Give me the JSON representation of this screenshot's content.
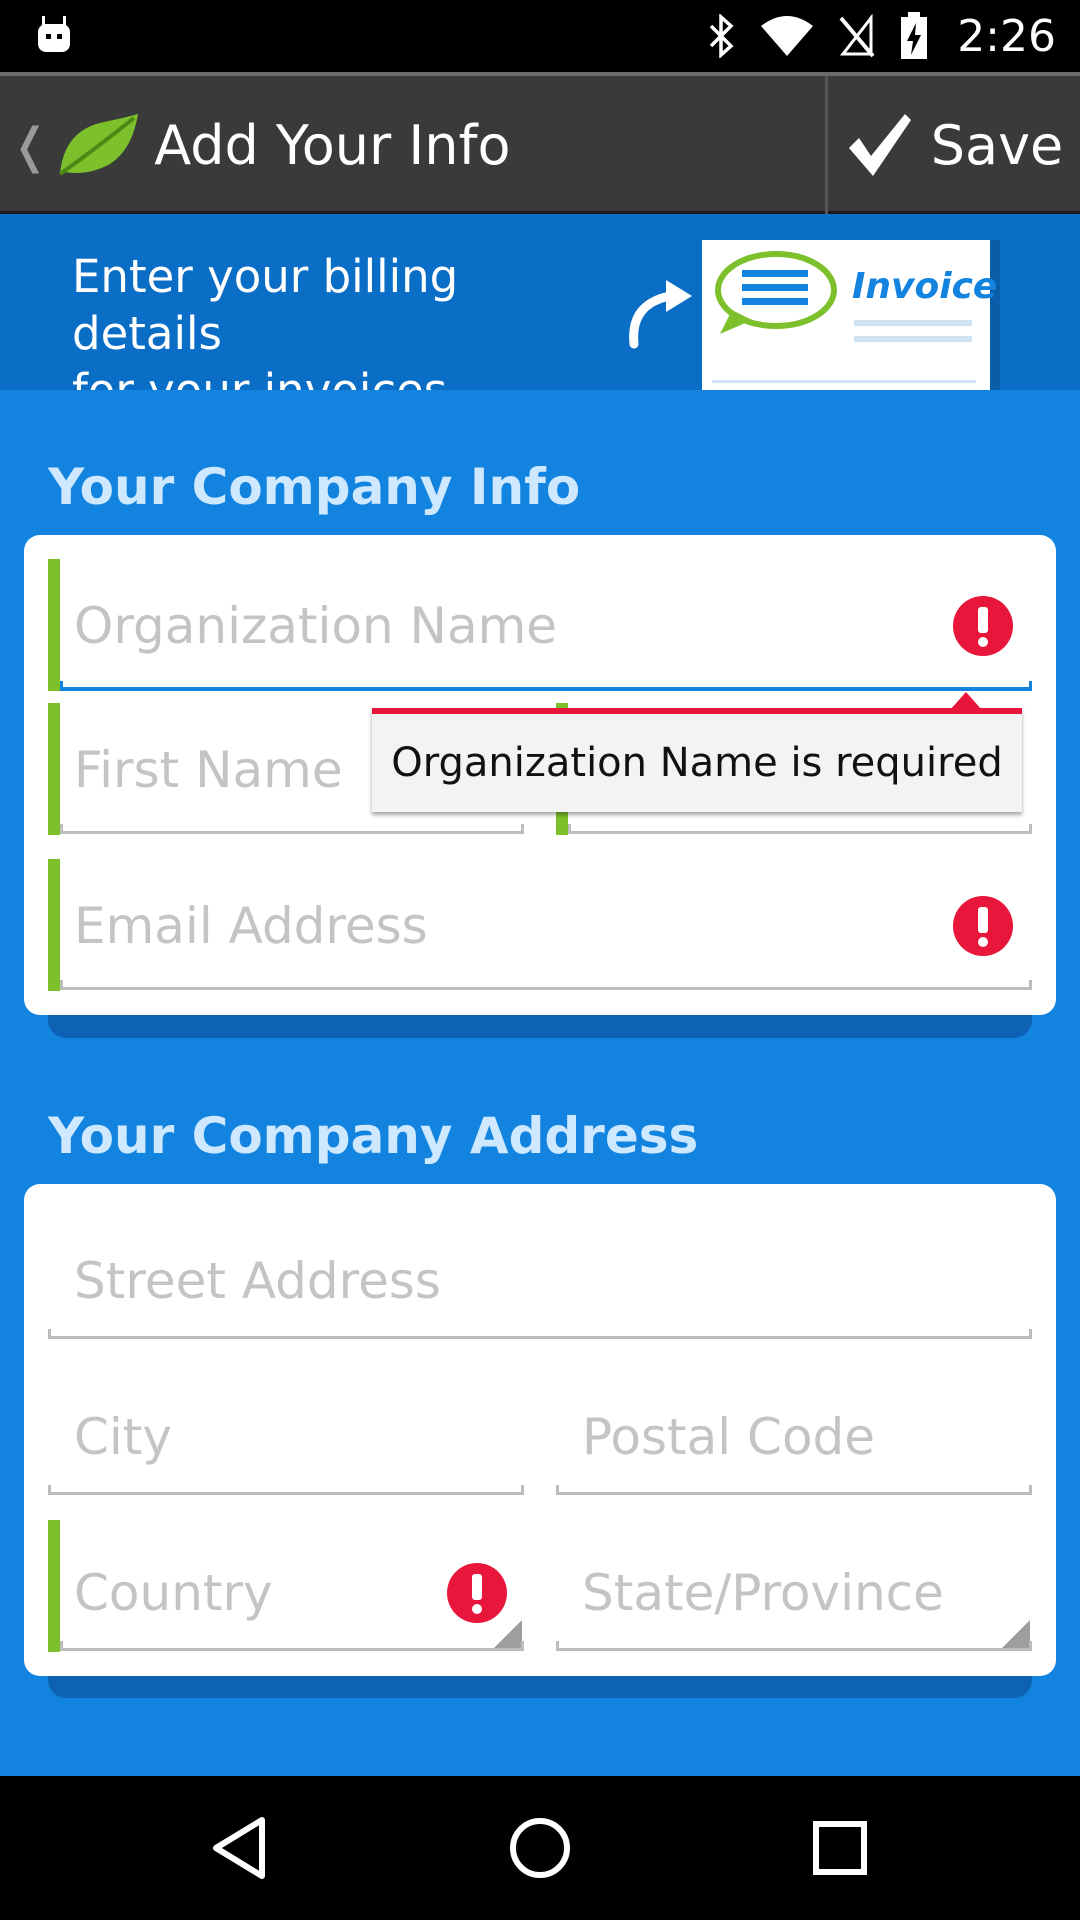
{
  "status_bar": {
    "time": "2:26"
  },
  "action_bar": {
    "title": "Add Your Info",
    "save_label": "Save"
  },
  "banner": {
    "line1": "Enter your billing details",
    "line2": "for your invoices",
    "invoice_label": "Invoice"
  },
  "company_info": {
    "title": "Your Company Info",
    "organization_placeholder": "Organization Name",
    "first_name_placeholder": "First Name",
    "email_placeholder": "Email Address"
  },
  "tooltip": {
    "message": "Organization Name is required"
  },
  "company_address": {
    "title": "Your Company Address",
    "street_placeholder": "Street Address",
    "city_placeholder": "City",
    "postal_placeholder": "Postal Code",
    "country_placeholder": "Country",
    "state_placeholder": "State/Province"
  },
  "colors": {
    "background": "#1283de",
    "accent_green": "#7cc12b",
    "error_red": "#e8163b",
    "action_bar": "#3a3a3a"
  },
  "icons": [
    "android-icon",
    "bluetooth-icon",
    "wifi-icon",
    "no-sim-icon",
    "battery-icon",
    "back-chevron-icon",
    "leaf-logo-icon",
    "checkmark-icon",
    "curved-arrow-icon",
    "error-icon",
    "back-nav-icon",
    "home-nav-icon",
    "recents-nav-icon"
  ]
}
